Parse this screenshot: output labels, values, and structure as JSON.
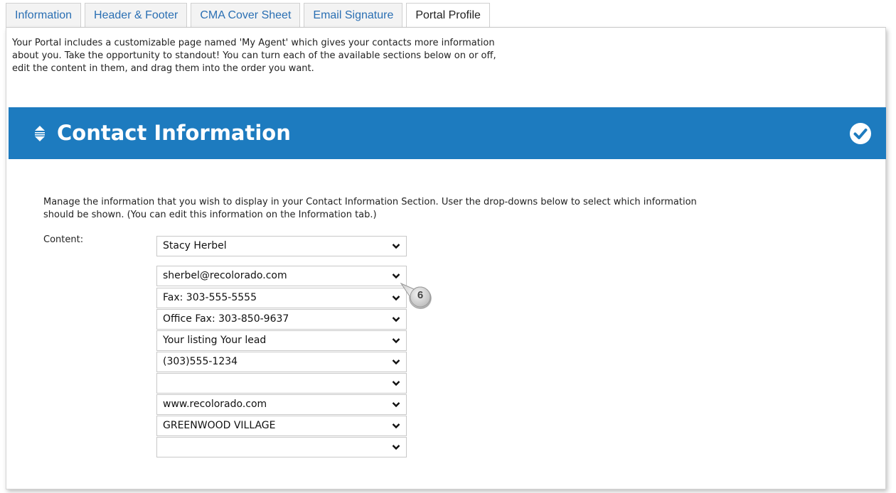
{
  "tabs": [
    {
      "label": "Information",
      "active": false
    },
    {
      "label": "Header & Footer",
      "active": false
    },
    {
      "label": "CMA Cover Sheet",
      "active": false
    },
    {
      "label": "Email Signature",
      "active": false
    },
    {
      "label": "Portal Profile",
      "active": true
    }
  ],
  "intro": {
    "line1": "Your Portal includes a customizable page named 'My Agent' which gives your contacts more information",
    "line2": "about you. Take the opportunity to standout! You can turn each of the available sections below on or off,",
    "line3": "edit the content in them, and drag them into the order you want."
  },
  "section": {
    "title": "Contact Information",
    "header_color": "#1d7bbf",
    "drag_icon": "drag-handle-icon",
    "status_icon": "check-circle-icon",
    "description_line1": "Manage the information that you wish to display in your Contact Information Section. User the drop-downs below to select which information",
    "description_line2": "should be shown. (You can edit this information on the Information tab.)",
    "content_label": "Content:"
  },
  "dropdowns": [
    "Stacy Herbel",
    "sherbel@recolorado.com",
    "Fax: 303-555-5555",
    "Office Fax: 303-850-9637",
    "Your listing Your lead",
    "(303)555-1234",
    "",
    "www.recolorado.com",
    "GREENWOOD VILLAGE",
    ""
  ],
  "callout": {
    "number": "6"
  }
}
